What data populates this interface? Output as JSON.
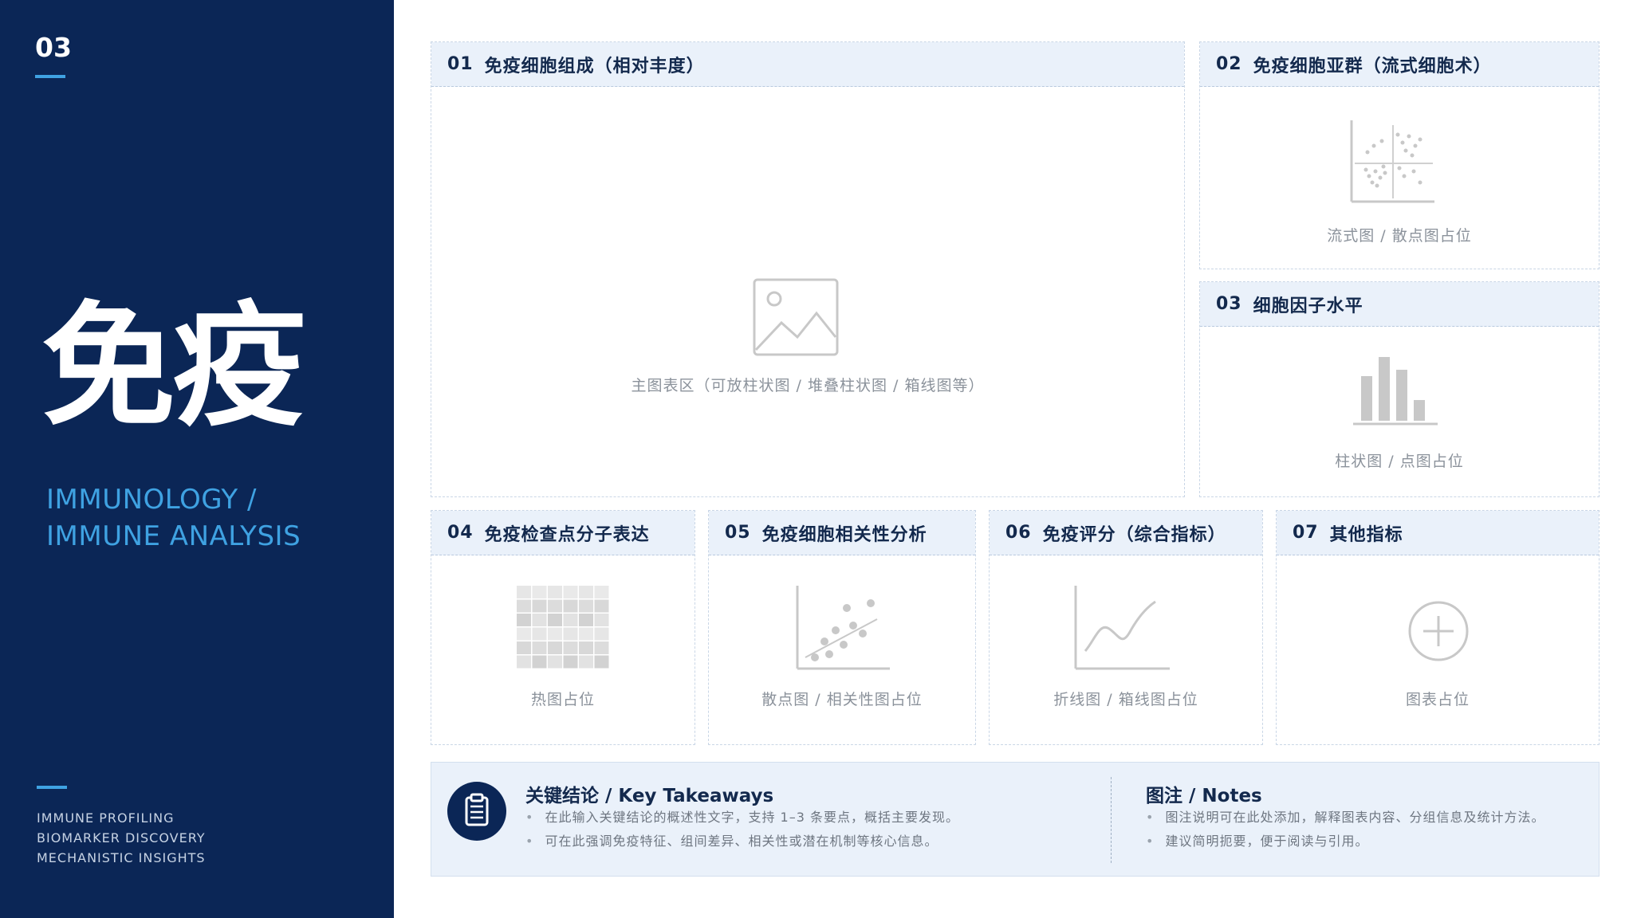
{
  "sidebar": {
    "page_number": "03",
    "title": "免疫",
    "subtitle_line1": "IMMUNOLOGY /",
    "subtitle_line2": "IMMUNE ANALYSIS",
    "bottom_items": [
      "IMMUNE PROFILING",
      "BIOMARKER DISCOVERY",
      "MECHANISTIC INSIGHTS"
    ]
  },
  "panels": {
    "p01": {
      "num": "01",
      "title": "免疫细胞组成（相对丰度）",
      "placeholder": "主图表区（可放柱状图 / 堆叠柱状图 / 箱线图等）",
      "icon": "image-icon"
    },
    "p02": {
      "num": "02",
      "title": "免疫细胞亚群（流式细胞术）",
      "placeholder": "流式图 / 散点图占位",
      "icon": "flow-cytometry-icon"
    },
    "p03": {
      "num": "03",
      "title": "细胞因子水平",
      "placeholder": "柱状图 / 点图占位",
      "icon": "bar-chart-icon"
    },
    "p04": {
      "num": "04",
      "title": "免疫检查点分子表达",
      "placeholder": "热图占位",
      "icon": "heatmap-icon"
    },
    "p05": {
      "num": "05",
      "title": "免疫细胞相关性分析",
      "placeholder": "散点图 / 相关性图占位",
      "icon": "scatter-plot-icon"
    },
    "p06": {
      "num": "06",
      "title": "免疫评分（综合指标）",
      "placeholder": "折线图 / 箱线图占位",
      "icon": "line-chart-icon"
    },
    "p07": {
      "num": "07",
      "title": "其他指标",
      "placeholder": "图表占位",
      "icon": "plus-circle-icon"
    }
  },
  "summary": {
    "icon": "clipboard-icon",
    "key_title": "关键结论 / Key Takeaways",
    "key_bullets": [
      "在此输入关键结论的概述性文字，支持 1–3 条要点，概括主要发现。",
      "可在此强调免疫特征、组间差异、相关性或潜在机制等核心信息。"
    ],
    "notes_title": "图注 / Notes",
    "notes_bullets": [
      "图注说明可在此处添加，解释图表内容、分组信息及统计方法。",
      "建议简明扼要，便于阅读与引用。"
    ]
  },
  "colors": {
    "sidebar_bg": "#0b2656",
    "accent": "#3fa2e2",
    "panel_header_bg": "#eaf1fa",
    "placeholder_grey": "#c8c8c8"
  }
}
